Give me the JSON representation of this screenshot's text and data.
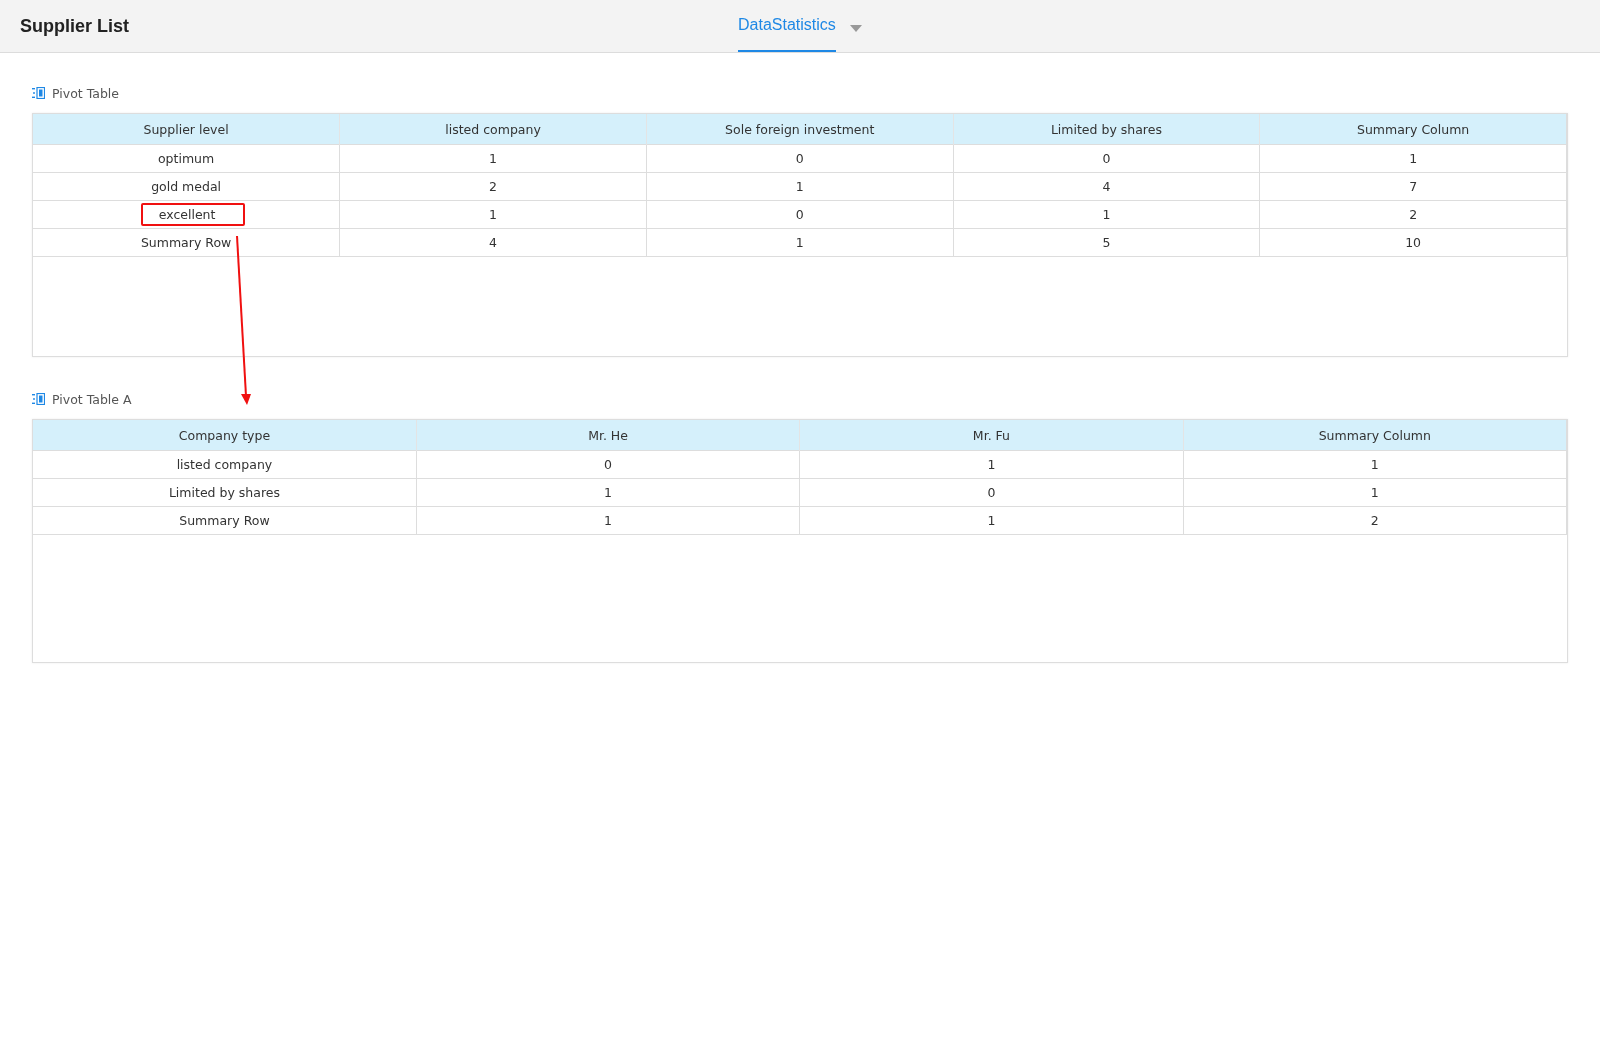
{
  "header": {
    "title": "Supplier List",
    "tabs": [
      {
        "label": "DataStatistics",
        "selected": true
      }
    ]
  },
  "pivot_tables": [
    {
      "title": "Pivot Table",
      "columns": [
        "Supplier level",
        "listed company",
        "Sole foreign investment",
        "Limited by shares",
        "Summary Column"
      ],
      "rows": [
        {
          "cells": [
            "optimum",
            "1",
            "0",
            "0",
            "1"
          ],
          "highlighted": false
        },
        {
          "cells": [
            "gold medal",
            "2",
            "1",
            "4",
            "7"
          ],
          "highlighted": false
        },
        {
          "cells": [
            "excellent",
            "1",
            "0",
            "1",
            "2"
          ],
          "highlighted": true
        },
        {
          "cells": [
            "Summary Row",
            "4",
            "1",
            "5",
            "10"
          ],
          "highlighted": false
        }
      ]
    },
    {
      "title": "Pivot Table A",
      "columns": [
        "Company type",
        "Mr. He",
        "Mr. Fu",
        "Summary Column"
      ],
      "rows": [
        {
          "cells": [
            "listed company",
            "0",
            "1",
            "1"
          ],
          "highlighted": false
        },
        {
          "cells": [
            "Limited by shares",
            "1",
            "0",
            "1"
          ],
          "highlighted": false
        },
        {
          "cells": [
            "Summary Row",
            "1",
            "1",
            "2"
          ],
          "highlighted": false
        }
      ]
    }
  ]
}
